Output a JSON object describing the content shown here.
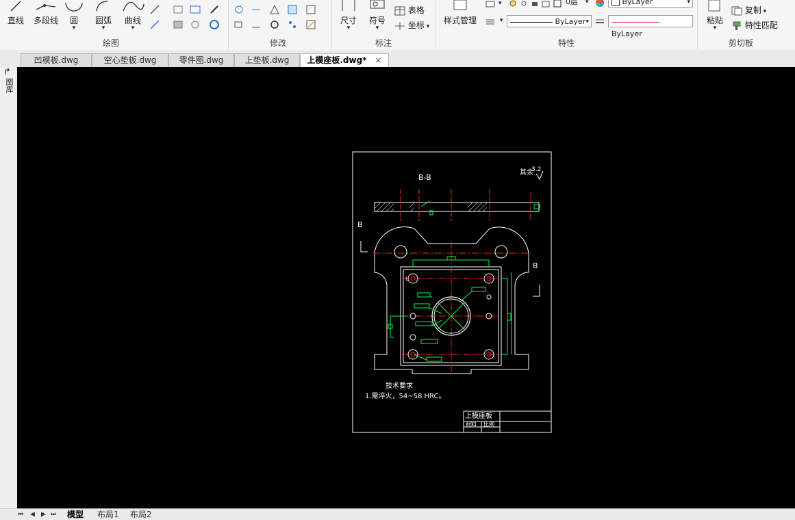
{
  "ribbon": {
    "draw": {
      "line": "直线",
      "polyline": "多段线",
      "circle": "圆",
      "arc": "圆弧",
      "curve": "曲线",
      "group": "绘图"
    },
    "modify": {
      "group": "修改"
    },
    "annotate": {
      "dimension": "尺寸",
      "symbol": "符号",
      "table": "表格",
      "coordinate": "坐标",
      "group": "标注"
    },
    "properties": {
      "style_manager": "样式管理",
      "layer": "0层",
      "color": "ByLayer",
      "linetype": "ByLayer",
      "lineweight": "ByLayer",
      "group": "特性"
    },
    "clipboard": {
      "paste": "粘贴",
      "copy": "复制",
      "match": "特性匹配",
      "group": "剪切板"
    }
  },
  "left_strip": {
    "label": "图库"
  },
  "tabs": [
    {
      "label": "凹模板.dwg"
    },
    {
      "label": "空心垫板.dwg"
    },
    {
      "label": "零件图.dwg"
    },
    {
      "label": "上垫板.dwg"
    },
    {
      "label": "上模座板.dwg*",
      "active": true
    }
  ],
  "tab_close": "×",
  "drawing": {
    "section_label": "B-B",
    "roughness_text": "其余",
    "roughness_value": "3.2",
    "view_mark_b": "B",
    "tech_req_title": "技术要求",
    "tech_req_1": "1.需淬火，54~58 HRC。",
    "title_block_name": "上模座板",
    "title_block_material": "材料",
    "title_block_scale": "比例",
    "pos_mark": "L"
  },
  "bottom": {
    "nav": [
      "⏮",
      "◀",
      "▶",
      "⏭"
    ],
    "tabs": [
      "模型",
      "布局1",
      "布局2"
    ]
  },
  "colors": {
    "canvas": "#000000",
    "line": "#ffffff",
    "center": "#ff0000",
    "dim": "#00ff00"
  }
}
